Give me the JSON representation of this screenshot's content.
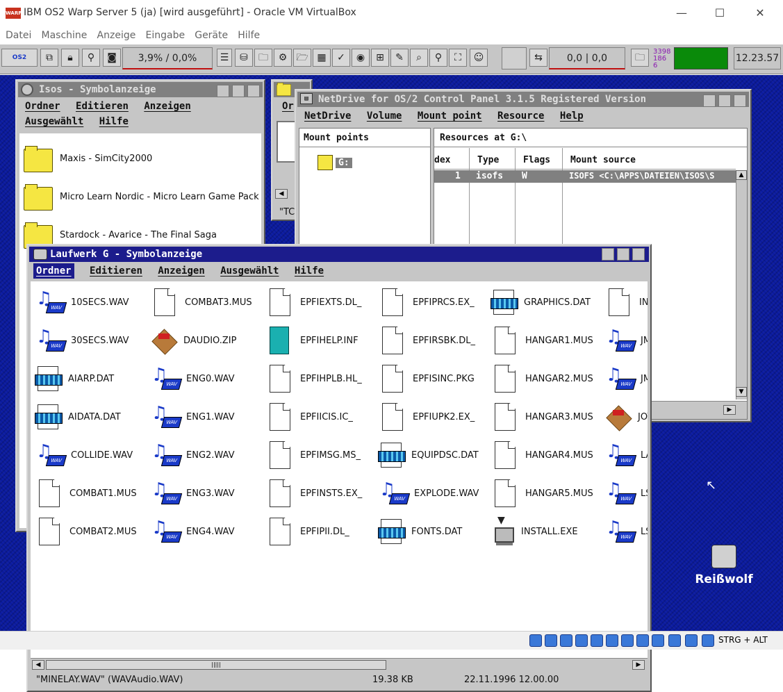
{
  "host": {
    "title": "IBM OS2 Warp Server 5 (ja) [wird ausgeführt] - Oracle VM VirtualBox",
    "logo_text": "WARP",
    "menu": [
      "Datei",
      "Maschine",
      "Anzeige",
      "Eingabe",
      "Geräte",
      "Hilfe"
    ],
    "minimize": "—",
    "maximize": "☐",
    "close": "✕",
    "taskbar_label": "STRG + ALT"
  },
  "warpcenter": {
    "os2_label": "OS2",
    "cpu_load": "3,9% / 0,0%",
    "swap": "0,0 | 0,0",
    "mem_top": "3398",
    "mem_mid": "186",
    "mem_bot": "6",
    "clock": "12.23.57",
    "accent_green": "#0a8a0a"
  },
  "isos": {
    "title": "Isos - Symbolanzeige",
    "menu": [
      "Ordner",
      "Editieren",
      "Anzeigen",
      "Ausgewählt",
      "Hilfe"
    ],
    "items": [
      "Maxis - SimCity2000",
      "Micro Learn Nordic - Micro Learn Game Pack",
      "Stardock - Avarice - The Final Saga"
    ]
  },
  "bg_window": {
    "menu_fragment": "Or",
    "status_fragment": "\"TC"
  },
  "netdrive": {
    "title": "NetDrive for OS/2 Control Panel 3.1.5 Registered Version",
    "menu": [
      "NetDrive",
      "Volume",
      "Mount point",
      "Resource",
      "Help"
    ],
    "mount_points_header": "Mount points",
    "mount_point": "G:",
    "resources_header": "Resources at G:\\",
    "columns": [
      "dex",
      "Type",
      "Flags",
      "Mount source"
    ],
    "row": [
      "1",
      "isofs",
      "W",
      "ISOFS <C:\\APPS\\DATEIEN\\ISOS\\S"
    ]
  },
  "laufwerk": {
    "title": "Laufwerk G - Symbolanzeige",
    "menu": [
      "Ordner",
      "Editieren",
      "Anzeigen",
      "Ausgewählt",
      "Hilfe"
    ],
    "columns": [
      [
        {
          "n": "10SECS.WAV",
          "t": "wav"
        },
        {
          "n": "30SECS.WAV",
          "t": "wav"
        },
        {
          "n": "AIARP.DAT",
          "t": "dat"
        },
        {
          "n": "AIDATA.DAT",
          "t": "dat"
        },
        {
          "n": "COLLIDE.WAV",
          "t": "wav"
        },
        {
          "n": "COMBAT1.MUS",
          "t": "file"
        },
        {
          "n": "COMBAT2.MUS",
          "t": "file"
        }
      ],
      [
        {
          "n": "COMBAT3.MUS",
          "t": "file"
        },
        {
          "n": "DAUDIO.ZIP",
          "t": "zip"
        },
        {
          "n": "ENG0.WAV",
          "t": "wav"
        },
        {
          "n": "ENG1.WAV",
          "t": "wav"
        },
        {
          "n": "ENG2.WAV",
          "t": "wav"
        },
        {
          "n": "ENG3.WAV",
          "t": "wav"
        },
        {
          "n": "ENG4.WAV",
          "t": "wav"
        }
      ],
      [
        {
          "n": "EPFIEXTS.DL_",
          "t": "file"
        },
        {
          "n": "EPFIHELP.INF",
          "t": "book"
        },
        {
          "n": "EPFIHPLB.HL_",
          "t": "file"
        },
        {
          "n": "EPFIICIS.IC_",
          "t": "file"
        },
        {
          "n": "EPFIMSG.MS_",
          "t": "file"
        },
        {
          "n": "EPFINSTS.EX_",
          "t": "file"
        },
        {
          "n": "EPFIPII.DL_",
          "t": "file"
        }
      ],
      [
        {
          "n": "EPFIPRCS.EX_",
          "t": "file"
        },
        {
          "n": "EPFIRSBK.DL_",
          "t": "file"
        },
        {
          "n": "EPFISINC.PKG",
          "t": "file"
        },
        {
          "n": "EPFIUPK2.EX_",
          "t": "file"
        },
        {
          "n": "EQUIPDSC.DAT",
          "t": "dat"
        },
        {
          "n": "EXPLODE.WAV",
          "t": "wav"
        },
        {
          "n": "FONTS.DAT",
          "t": "dat"
        }
      ],
      [
        {
          "n": "GRAPHICS.DAT",
          "t": "dat"
        },
        {
          "n": "HANGAR1.MUS",
          "t": "file"
        },
        {
          "n": "HANGAR2.MUS",
          "t": "file"
        },
        {
          "n": "HANGAR3.MUS",
          "t": "file"
        },
        {
          "n": "HANGAR4.MUS",
          "t": "file"
        },
        {
          "n": "HANGAR5.MUS",
          "t": "file"
        },
        {
          "n": "INSTALL.EXE",
          "t": "exe"
        }
      ],
      [
        {
          "n": "INST",
          "t": "file"
        },
        {
          "n": "JMF",
          "t": "wav"
        },
        {
          "n": "JMF",
          "t": "wav"
        },
        {
          "n": "JOY",
          "t": "zip"
        },
        {
          "n": "LAS",
          "t": "wav"
        },
        {
          "n": "LSR",
          "t": "wav"
        },
        {
          "n": "LSR",
          "t": "wav"
        }
      ]
    ],
    "status_name": "\"MINELAY.WAV\" (WAVAudio.WAV)",
    "status_size": "19.38 KB",
    "status_date": "22.11.1996 12.00.00"
  },
  "desktop": {
    "shredder_label": "Reißwolf"
  }
}
